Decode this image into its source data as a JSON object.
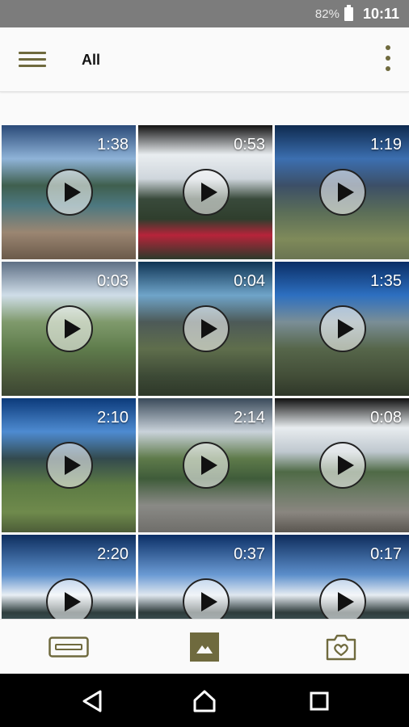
{
  "status_bar": {
    "battery": "82%",
    "time": "10:11"
  },
  "app_bar": {
    "title": "All",
    "menu_icon": "hamburger-menu-icon",
    "overflow_icon": "more-vertical-icon"
  },
  "videos": [
    {
      "duration": "1:38"
    },
    {
      "duration": "0:53"
    },
    {
      "duration": "1:19"
    },
    {
      "duration": "0:03"
    },
    {
      "duration": "0:04"
    },
    {
      "duration": "1:35"
    },
    {
      "duration": "2:10"
    },
    {
      "duration": "2:14"
    },
    {
      "duration": "0:08"
    },
    {
      "duration": "2:20"
    },
    {
      "duration": "0:37"
    },
    {
      "duration": "0:17"
    }
  ],
  "bottom_nav": [
    {
      "icon": "tape-icon"
    },
    {
      "icon": "gallery-icon",
      "active": true
    },
    {
      "icon": "camera-heart-icon"
    }
  ],
  "system_nav": [
    {
      "icon": "back-icon"
    },
    {
      "icon": "home-icon"
    },
    {
      "icon": "recents-icon"
    }
  ],
  "colors": {
    "accent": "#6f6a3e",
    "status_bar": "#7c7c7c"
  }
}
